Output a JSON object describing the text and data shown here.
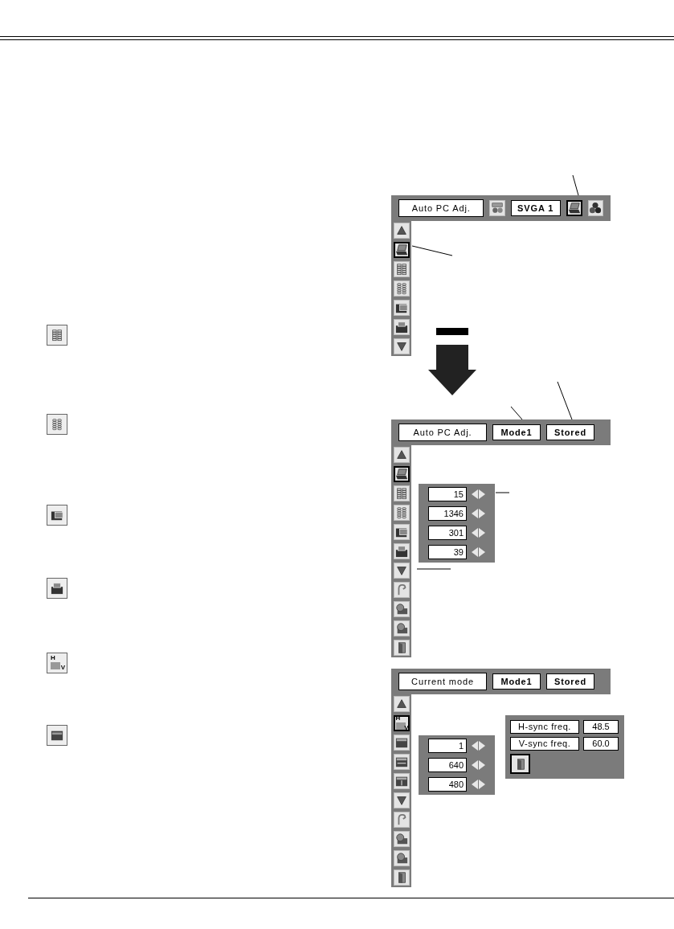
{
  "left_icons": [
    {
      "kind": "grid-a"
    },
    {
      "kind": "grid-b"
    },
    {
      "kind": "window-a"
    },
    {
      "kind": "window-b"
    },
    {
      "kind": "hv",
      "marks": [
        "H",
        "V"
      ]
    },
    {
      "kind": "window-c"
    }
  ],
  "menus": [
    {
      "header": [
        {
          "kind": "title",
          "text": "Auto PC Adj."
        },
        {
          "kind": "gadget",
          "selected": false
        },
        {
          "kind": "label",
          "text": "SVGA 1"
        },
        {
          "kind": "laptop",
          "selected": true
        },
        {
          "kind": "balls",
          "selected": false
        }
      ],
      "sidebar": [
        {
          "kind": "up",
          "selected": false
        },
        {
          "kind": "laptop",
          "selected": true
        },
        {
          "kind": "grid-a",
          "selected": false
        },
        {
          "kind": "grid-b",
          "selected": false
        },
        {
          "kind": "window-a",
          "selected": false
        },
        {
          "kind": "window-b",
          "selected": false
        },
        {
          "kind": "down",
          "selected": false
        }
      ]
    },
    {
      "header": [
        {
          "kind": "title",
          "text": "Auto PC Adj."
        },
        {
          "kind": "label",
          "text": "Mode1"
        },
        {
          "kind": "label",
          "text": "Stored"
        }
      ],
      "sidebar": [
        {
          "kind": "up",
          "selected": false
        },
        {
          "kind": "laptop",
          "selected": true
        },
        {
          "kind": "grid-a",
          "selected": false
        },
        {
          "kind": "grid-b",
          "selected": false
        },
        {
          "kind": "window-a",
          "selected": false
        },
        {
          "kind": "window-b",
          "selected": false
        },
        {
          "kind": "down",
          "selected": false
        },
        {
          "kind": "hook",
          "selected": false
        },
        {
          "kind": "camera-a",
          "selected": false
        },
        {
          "kind": "camera-b",
          "selected": false
        },
        {
          "kind": "door",
          "selected": false
        }
      ],
      "values": [
        {
          "value": "15"
        },
        {
          "value": "1346"
        },
        {
          "value": "301"
        },
        {
          "value": "39"
        }
      ]
    },
    {
      "header": [
        {
          "kind": "title",
          "text": "Current mode"
        },
        {
          "kind": "label",
          "text": "Mode1"
        },
        {
          "kind": "label",
          "text": "Stored"
        }
      ],
      "sidebar": [
        {
          "kind": "up",
          "selected": false
        },
        {
          "kind": "hv",
          "marks": [
            "H",
            "V"
          ],
          "selected": true
        },
        {
          "kind": "bar-a",
          "selected": false
        },
        {
          "kind": "bar-b",
          "selected": false
        },
        {
          "kind": "bar-c",
          "selected": false
        },
        {
          "kind": "down",
          "selected": false
        },
        {
          "kind": "hook",
          "selected": false
        },
        {
          "kind": "camera-a",
          "selected": false
        },
        {
          "kind": "camera-b",
          "selected": false
        },
        {
          "kind": "door",
          "selected": false
        }
      ],
      "values": [
        {
          "value": "1"
        },
        {
          "value": "640"
        },
        {
          "value": "480"
        }
      ],
      "info": {
        "rows": [
          {
            "label": "H-sync freq.",
            "value": "48.5"
          },
          {
            "label": "V-sync freq.",
            "value": "60.0"
          }
        ]
      }
    }
  ]
}
